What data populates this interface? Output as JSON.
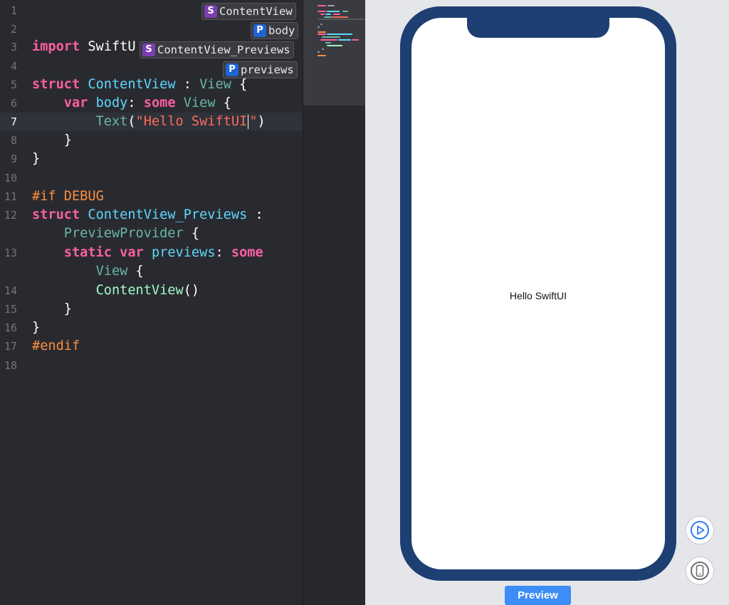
{
  "editor": {
    "line_numbers": [
      "1",
      "2",
      "3",
      "4",
      "5",
      "6",
      "7",
      "8",
      "9",
      "10",
      "11",
      "12",
      "13",
      "14",
      "15",
      "16",
      "17",
      "18"
    ],
    "lines": {
      "l3": {
        "kw": "import",
        "rest": " SwiftU"
      },
      "l5": {
        "kw": "struct",
        "sp": " ",
        "type": "ContentView",
        "mid": " : ",
        "proto": "View",
        "end": " {"
      },
      "l6": {
        "indent": "    ",
        "kw1": "var",
        "sp": " ",
        "name": "body",
        "colon": ": ",
        "kw2": "some",
        "sp2": " ",
        "proto": "View",
        "end": " {"
      },
      "l7": {
        "indent": "        ",
        "call": "Text",
        "open": "(",
        "str_a": "\"Hello SwiftUI",
        "str_b": "\"",
        "close": ")"
      },
      "l8": {
        "text": "    }"
      },
      "l9": {
        "text": "}"
      },
      "l11": {
        "pp": "#if",
        "rest": " DEBUG"
      },
      "l12": {
        "kw": "struct",
        "sp": " ",
        "type": "ContentView_Previews",
        "end": " :"
      },
      "l12b": {
        "indent": "    ",
        "proto": "PreviewProvider",
        "end": " {"
      },
      "l13": {
        "indent": "    ",
        "kw1": "static",
        "sp": " ",
        "kw2": "var",
        "sp2": " ",
        "name": "previews",
        "colon": ": ",
        "kw3": "some"
      },
      "l13b": {
        "indent": "        ",
        "proto": "View",
        "end": " {"
      },
      "l14": {
        "indent": "        ",
        "call": "ContentView",
        "end": "()"
      },
      "l15": {
        "text": "    }"
      },
      "l16": {
        "text": "}"
      },
      "l17": {
        "pp": "#endif"
      }
    },
    "jump_bar": [
      {
        "badge": "S",
        "label": "ContentView"
      },
      {
        "badge": "P",
        "label": "body"
      },
      {
        "badge": "S",
        "label": "ContentView_Previews"
      },
      {
        "badge": "P",
        "label": "previews"
      }
    ]
  },
  "preview": {
    "device_text": "Hello SwiftUI",
    "button_label": "Preview",
    "icons": [
      "play-icon",
      "device-icon"
    ]
  },
  "colors": {
    "editor_bg": "#292a30",
    "keyword": "#fc5fa3",
    "type": "#5dd8ff",
    "string": "#fc6a5d",
    "preprocessor": "#fd8f3f",
    "device_frame": "#1d3f72",
    "accent": "#3c8df5"
  }
}
